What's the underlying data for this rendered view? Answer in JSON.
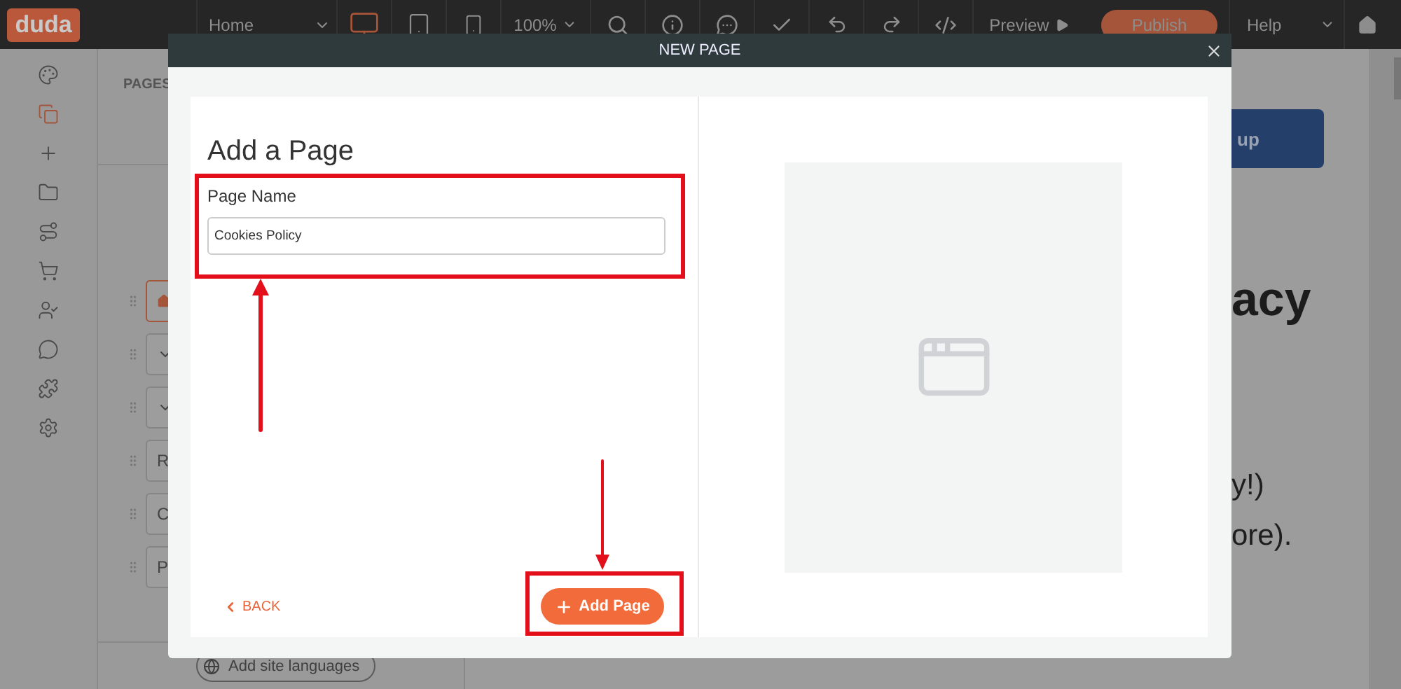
{
  "top_bar": {
    "logo": "duda",
    "page_select": "Home",
    "devices": [
      {
        "kind": "desktop",
        "selected": true
      },
      {
        "kind": "tablet",
        "selected": false
      },
      {
        "kind": "mobile",
        "selected": false
      }
    ],
    "zoom": "100%",
    "preview": "Preview",
    "publish": "Publish",
    "help": "Help"
  },
  "rail": [
    {
      "kind": "palette",
      "selected": false
    },
    {
      "kind": "pages",
      "selected": true
    },
    {
      "kind": "add",
      "selected": false
    },
    {
      "kind": "folder",
      "selected": false
    },
    {
      "kind": "flow",
      "selected": false
    },
    {
      "kind": "cart",
      "selected": false
    },
    {
      "kind": "user",
      "selected": false
    },
    {
      "kind": "chat",
      "selected": false
    },
    {
      "kind": "puzzle",
      "selected": false
    },
    {
      "kind": "settings",
      "selected": false
    }
  ],
  "pages_panel": {
    "title": "PAGES",
    "items": [
      {
        "kind": "home",
        "selected": true
      },
      {
        "kind": "folder",
        "selected": false
      },
      {
        "kind": "folder",
        "selected": false
      },
      {
        "kind": "page",
        "label": "R",
        "selected": false
      },
      {
        "kind": "page",
        "label": "C",
        "selected": false
      },
      {
        "kind": "page",
        "label": "P",
        "selected": false
      }
    ],
    "languages_button": "Add site languages"
  },
  "canvas": {
    "button": "up",
    "heading": "acy",
    "lines": [
      "y!)",
      "ore)."
    ]
  },
  "dialog": {
    "title": "NEW PAGE",
    "heading": "Add a Page",
    "field_label": "Page Name",
    "field_value": "Cookies Policy",
    "back": "BACK",
    "submit": "Add Page"
  }
}
